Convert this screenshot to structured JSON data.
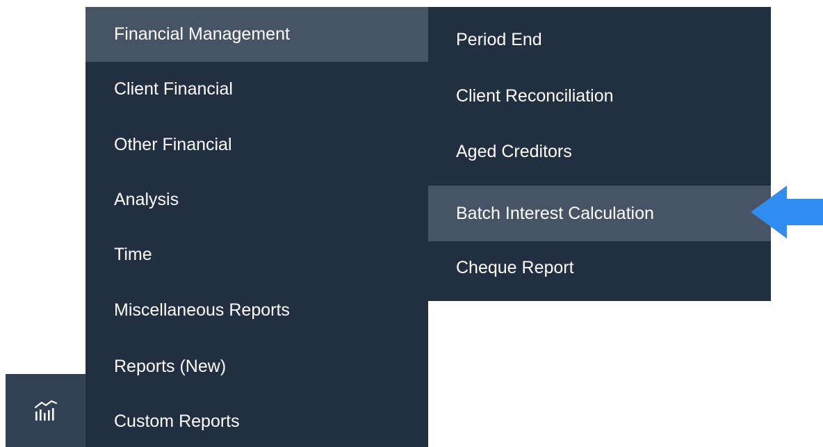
{
  "main_menu": {
    "items": [
      {
        "label": "Financial Management"
      },
      {
        "label": "Client Financial"
      },
      {
        "label": "Other Financial"
      },
      {
        "label": "Analysis"
      },
      {
        "label": "Time"
      },
      {
        "label": "Miscellaneous Reports"
      },
      {
        "label": "Reports (New)"
      },
      {
        "label": "Custom Reports"
      }
    ],
    "active_item": "Financial Management"
  },
  "submenu": {
    "items": [
      {
        "label": "Period End"
      },
      {
        "label": "Client Reconciliation"
      },
      {
        "label": "Aged Creditors"
      },
      {
        "label": "Batch Interest Calculation"
      },
      {
        "label": "Cheque Report"
      }
    ],
    "highlighted_item": "Batch Interest Calculation"
  },
  "icons": {
    "reports_icon": "reports-chart-icon",
    "pointer": "arrow-left-icon"
  },
  "colors": {
    "menu_background": "#212f40",
    "menu_active": "#475466",
    "icon_tile": "#334155",
    "pointer_arrow": "#2f8cf0",
    "text": "#ffffff"
  }
}
